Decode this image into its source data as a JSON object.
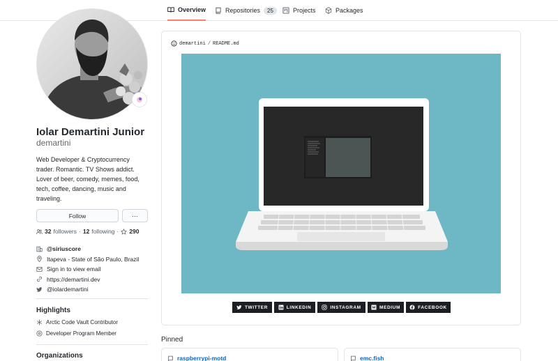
{
  "tabs": [
    {
      "label": "Overview",
      "icon": "book-icon",
      "active": true
    },
    {
      "label": "Repositories",
      "icon": "repo-icon",
      "count": "25"
    },
    {
      "label": "Projects",
      "icon": "project-icon"
    },
    {
      "label": "Packages",
      "icon": "package-icon"
    }
  ],
  "profile": {
    "full_name": "Iolar Demartini Junior",
    "username": "demartini",
    "bio": "Web Developer & Cryptocurrency trader. Romantic. TV Shows addict. Lover of beer, comedy, memes, food, tech, coffee, dancing, music and traveling.",
    "follow_label": "Follow",
    "more_label": "···",
    "followers_count": "32",
    "followers_label": "followers",
    "following_count": "12",
    "following_label": "following",
    "stars_count": "290",
    "company": "@siriuscore",
    "location": "Itapeva - State of São Paulo, Brazil",
    "email": "Sign in to view email",
    "website": "https://demartini.dev",
    "twitter": "@iolardemartini"
  },
  "highlights": {
    "title": "Highlights",
    "items": [
      "Arctic Code Vault Contributor",
      "Developer Program Member"
    ]
  },
  "organizations": {
    "title": "Organizations"
  },
  "readme": {
    "user": "demartini",
    "separator": "/",
    "file": "README.md"
  },
  "social_badges": [
    "TWITTER",
    "LINKEDIN",
    "INSTAGRAM",
    "MEDIUM",
    "FACEBOOK"
  ],
  "pinned": {
    "title": "Pinned",
    "repos": [
      "raspberrypi-motd",
      "emc.fish"
    ]
  },
  "colors": {
    "active_tab_underline": "#f9826c",
    "banner_background": "#6db8c4",
    "link": "#0366d6"
  }
}
